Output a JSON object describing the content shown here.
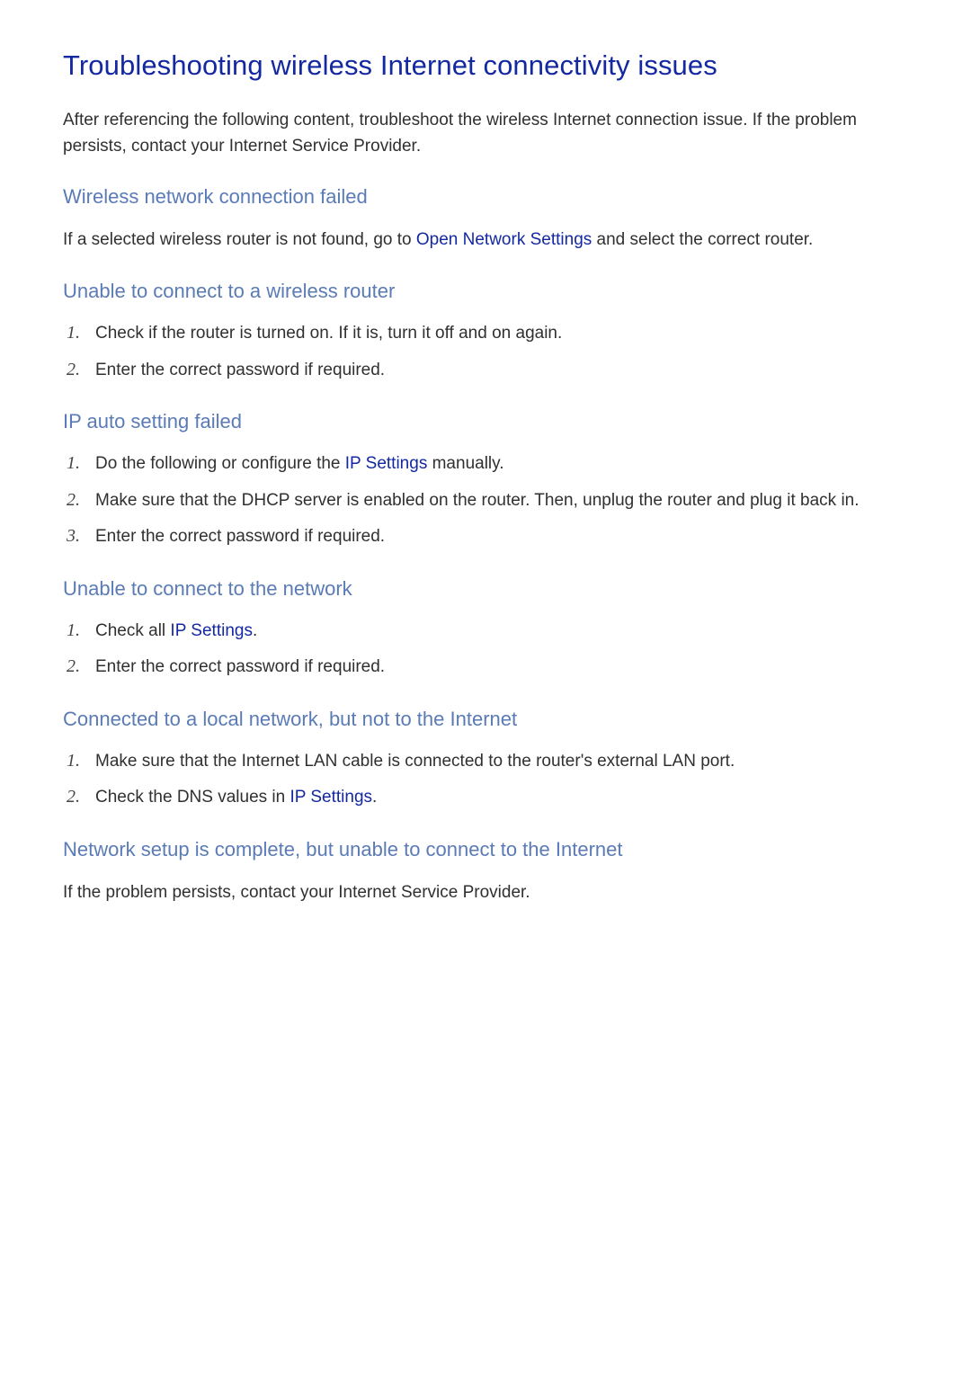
{
  "page": {
    "title": "Troubleshooting wireless Internet connectivity issues",
    "intro": "After referencing the following content, troubleshoot the wireless Internet connection issue. If the problem persists, contact your Internet Service Provider."
  },
  "sections": {
    "s1": {
      "heading": "Wireless network connection failed",
      "p_before": "If a selected wireless router is not found, go to ",
      "link": "Open Network Settings",
      "p_after": " and select the correct router."
    },
    "s2": {
      "heading": "Unable to connect to a wireless router",
      "items": {
        "n1": "1.",
        "t1": "Check if the router is turned on. If it is, turn it off and on again.",
        "n2": "2.",
        "t2": "Enter the correct password if required."
      }
    },
    "s3": {
      "heading": "IP auto setting failed",
      "items": {
        "n1": "1.",
        "t1_before": "Do the following or configure the ",
        "t1_link": "IP Settings",
        "t1_after": " manually.",
        "n2": "2.",
        "t2": "Make sure that the DHCP server is enabled on the router. Then, unplug the router and plug it back in.",
        "n3": "3.",
        "t3": "Enter the correct password if required."
      }
    },
    "s4": {
      "heading": "Unable to connect to the network",
      "items": {
        "n1": "1.",
        "t1_before": "Check all ",
        "t1_link": "IP Settings",
        "t1_after": ".",
        "n2": "2.",
        "t2": "Enter the correct password if required."
      }
    },
    "s5": {
      "heading": "Connected to a local network, but not to the Internet",
      "items": {
        "n1": "1.",
        "t1": "Make sure that the Internet LAN cable is connected to the router's external LAN port.",
        "n2": "2.",
        "t2_before": "Check the DNS values in ",
        "t2_link": "IP Settings",
        "t2_after": "."
      }
    },
    "s6": {
      "heading": "Network setup is complete, but unable to connect to the Internet",
      "p": "If the problem persists, contact your Internet Service Provider."
    }
  }
}
